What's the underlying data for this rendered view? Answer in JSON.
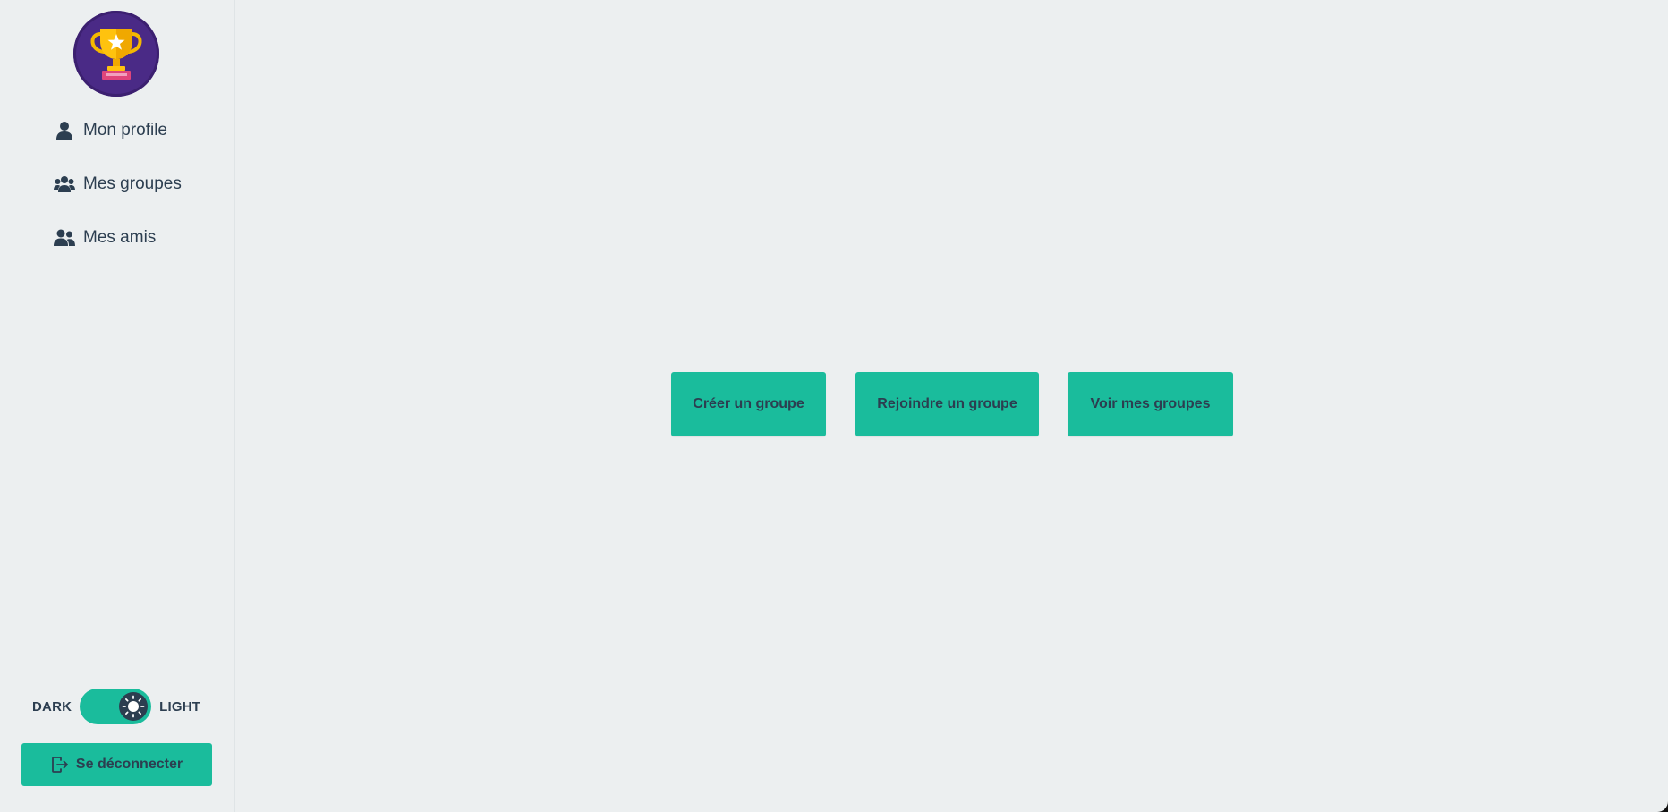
{
  "sidebar": {
    "logo_icon": "trophy-icon",
    "items": [
      {
        "label": "Mon profile",
        "icon": "user-icon"
      },
      {
        "label": "Mes groupes",
        "icon": "users-group-icon"
      },
      {
        "label": "Mes amis",
        "icon": "user-friends-icon"
      }
    ],
    "theme": {
      "dark_label": "DARK",
      "light_label": "LIGHT",
      "current": "light",
      "icon": "sun-icon"
    },
    "logout": {
      "label": "Se déconnecter",
      "icon": "sign-out-icon"
    }
  },
  "main": {
    "actions": [
      {
        "label": "Créer un groupe"
      },
      {
        "label": "Rejoindre un groupe"
      },
      {
        "label": "Voir mes groupes"
      }
    ]
  },
  "colors": {
    "background": "#eceff0",
    "accent": "#1abc9c",
    "text": "#2c3e50",
    "logo_bg": "#4a2a86"
  }
}
